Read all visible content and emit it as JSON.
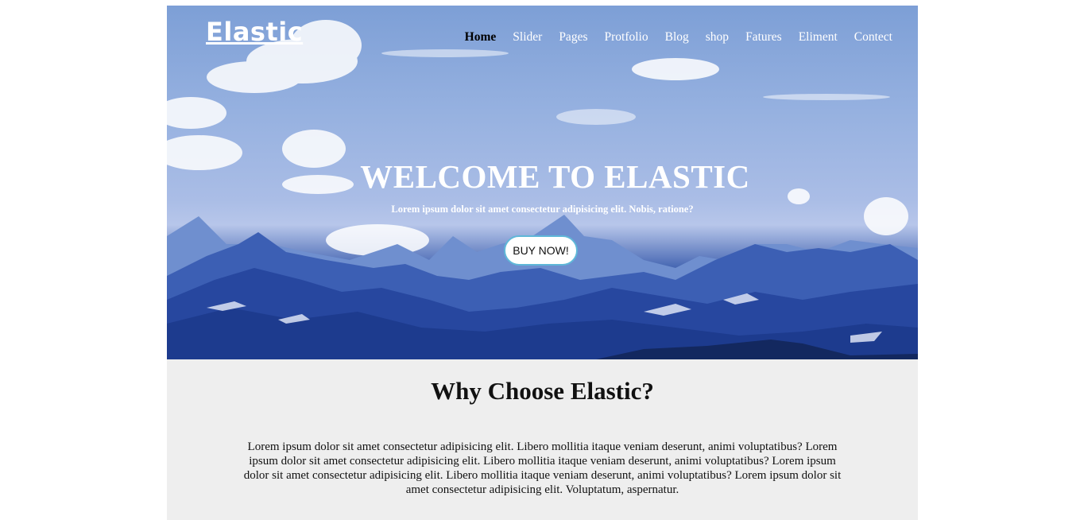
{
  "brand": {
    "logo": "Elastic"
  },
  "nav": {
    "items": [
      {
        "label": "Home",
        "active": true
      },
      {
        "label": "Slider"
      },
      {
        "label": "Pages"
      },
      {
        "label": "Protfolio"
      },
      {
        "label": "Blog"
      },
      {
        "label": "shop"
      },
      {
        "label": "Fatures"
      },
      {
        "label": "Eliment"
      },
      {
        "label": "Contect"
      }
    ]
  },
  "hero": {
    "title": "WELCOME TO ELASTIC",
    "subtitle": "Lorem ipsum dolor sit amet consectetur adipisicing elit. Nobis, ratione?",
    "button_label": "BUY NOW!"
  },
  "why": {
    "heading": "Why Choose Elastic?",
    "paragraph": "Lorem ipsum dolor sit amet consectetur adipisicing elit. Libero mollitia itaque veniam deserunt, animi voluptatibus? Lorem ipsum dolor sit amet consectetur adipisicing elit. Libero mollitia itaque veniam deserunt, animi voluptatibus? Lorem ipsum dolor sit amet consectetur adipisicing elit. Libero mollitia itaque veniam deserunt, animi voluptatibus? Lorem ipsum dolor sit amet consectetur adipisicing elit. Voluptatum, aspernatur."
  },
  "colors": {
    "sky_top": "#7d9fd6",
    "mountain_dark": "#1c3a8c",
    "section_bg": "#eeeeee",
    "button_border": "#5fb7d8"
  }
}
